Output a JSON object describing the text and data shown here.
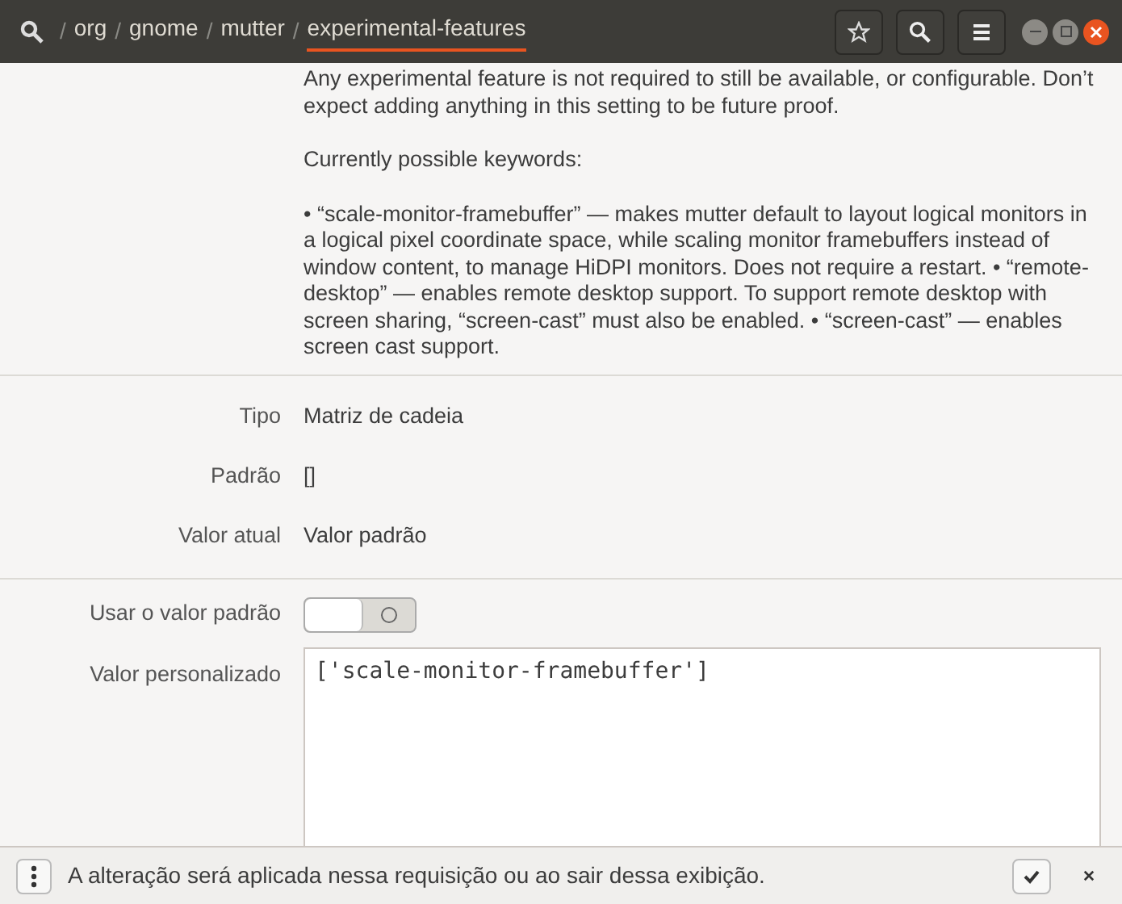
{
  "path_separator": "/",
  "path": [
    {
      "label": "org",
      "selected": false
    },
    {
      "label": "gnome",
      "selected": false
    },
    {
      "label": "mutter",
      "selected": false
    },
    {
      "label": "experimental-features",
      "selected": true
    }
  ],
  "description": [
    "Any experimental feature is not required to still be available, or configurable. Don’t expect adding anything in this setting to be future proof.",
    "Currently possible keywords:",
    "• “scale-monitor-framebuffer” — makes mutter default to layout logical monitors in a logical pixel coordinate space, while scaling monitor framebuffers instead of window content, to manage HiDPI monitors. Does not require a restart. • “remote-desktop” — enables remote desktop support. To support remote desktop with screen sharing, “screen-cast” must also be enabled. • “screen-cast” — enables screen cast support."
  ],
  "info": [
    {
      "label": "Tipo",
      "value": "Matriz de cadeia"
    },
    {
      "label": "Padrão",
      "value": "[]"
    },
    {
      "label": "Valor atual",
      "value": "Valor padrão"
    }
  ],
  "use_default": {
    "label": "Usar o valor padrão",
    "on": false
  },
  "custom_value": {
    "label": "Valor personalizado",
    "value": "['scale-monitor-framebuffer']"
  },
  "status_bar": {
    "message": "A alteração será aplicada nessa requisição ou ao sair dessa exibição."
  }
}
